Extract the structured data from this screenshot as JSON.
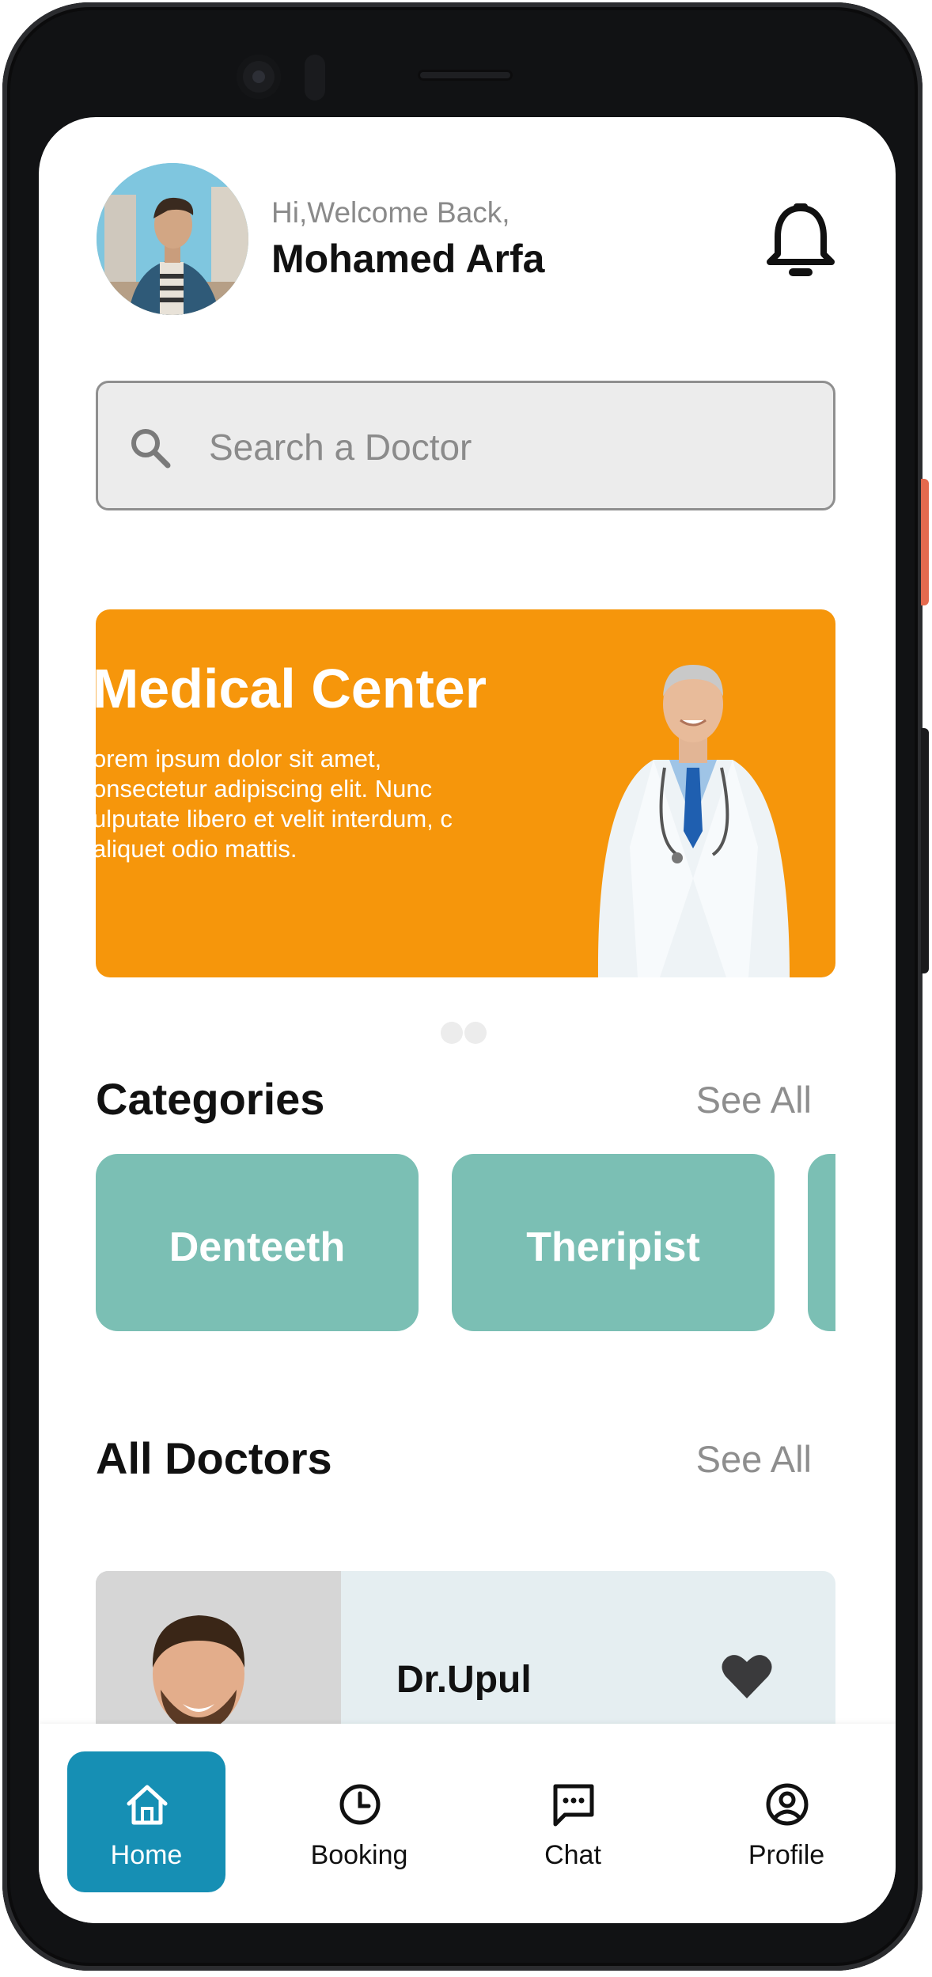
{
  "header": {
    "greeting": "Hi,Welcome Back,",
    "username": "Mohamed Arfa",
    "notification_icon": "bell-icon"
  },
  "search": {
    "placeholder": "Search a Doctor",
    "icon": "search-icon"
  },
  "banner": {
    "title": "Medical Center",
    "text": "orem ipsum dolor sit amet, onsectetur adipiscing elit. Nunc ulputate libero et velit interdum, c aliquet odio mattis.",
    "background_color": "#f6960b"
  },
  "categories": {
    "title": "Categories",
    "see_all": "See All",
    "items": [
      {
        "label": "Denteeth"
      },
      {
        "label": "Theripist"
      },
      {
        "label": ""
      }
    ],
    "color": "#7bbfb4"
  },
  "doctors": {
    "title": "All Doctors",
    "see_all": "See All",
    "items": [
      {
        "name": "Dr.Upul",
        "favorite_icon": "heart-icon"
      }
    ]
  },
  "bottom_nav": {
    "items": [
      {
        "label": "Home",
        "icon": "home-icon",
        "active": true
      },
      {
        "label": "Booking",
        "icon": "clock-icon",
        "active": false
      },
      {
        "label": "Chat",
        "icon": "chat-icon",
        "active": false
      },
      {
        "label": "Profile",
        "icon": "profile-icon",
        "active": false
      }
    ],
    "accent_color": "#168fb4"
  }
}
